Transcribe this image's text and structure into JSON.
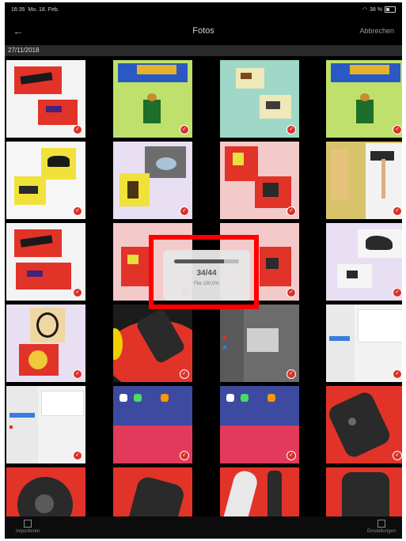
{
  "status_bar": {
    "time": "16:35",
    "date": "Mo. 18. Feb.",
    "wifi": "wifi-icon",
    "battery": "38 %"
  },
  "nav": {
    "back": "←",
    "title": "Fotos",
    "cancel": "Abbrechen"
  },
  "section": {
    "date": "27/11/2018"
  },
  "upload_dialog": {
    "count": "34/44",
    "subtitle": "File 100.0%",
    "progress": 0.77
  },
  "toolbar": {
    "left_label": "Importieren",
    "right_label": "Einstellungen"
  },
  "tiles": [
    {
      "name": "photo-red-cards-black-object"
    },
    {
      "name": "photo-lego-figure-green"
    },
    {
      "name": "photo-blue-squares-cards"
    },
    {
      "name": "photo-lego-figure-green-2"
    },
    {
      "name": "photo-yellow-cards"
    },
    {
      "name": "photo-purple-pattern-cards"
    },
    {
      "name": "photo-red-pink-cards"
    },
    {
      "name": "photo-hammer"
    },
    {
      "name": "photo-red-cards-black-object-2"
    },
    {
      "name": "photo-pink-cards"
    },
    {
      "name": "photo-pink-cards-2"
    },
    {
      "name": "photo-purple-shoe"
    },
    {
      "name": "photo-face-drawing"
    },
    {
      "name": "photo-red-device"
    },
    {
      "name": "photo-ipad-screen-gray"
    },
    {
      "name": "photo-ipad-settings"
    },
    {
      "name": "photo-ipad-settings-2"
    },
    {
      "name": "photo-ipad-home"
    },
    {
      "name": "photo-ipad-home-2"
    },
    {
      "name": "photo-red-device-2"
    },
    {
      "name": "photo-red-device-3"
    },
    {
      "name": "photo-red-device-4"
    },
    {
      "name": "photo-white-device"
    },
    {
      "name": "photo-red-device-5"
    }
  ]
}
